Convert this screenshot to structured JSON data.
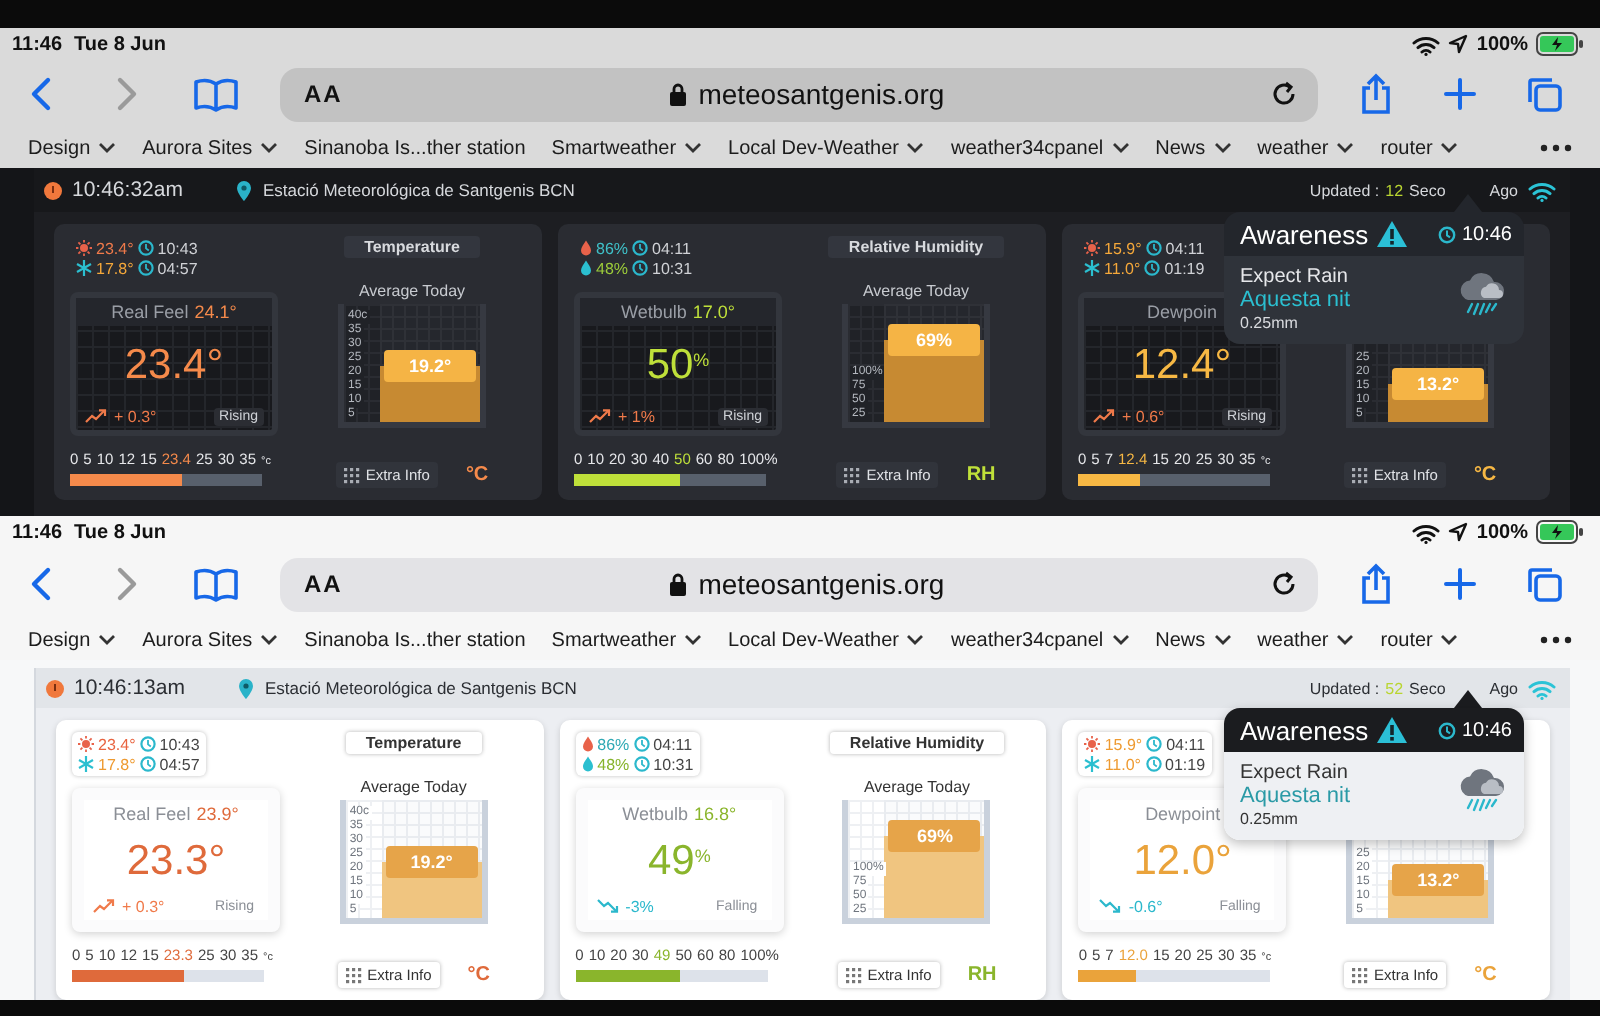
{
  "screens": [
    {
      "kind": "dark",
      "status_bar": {
        "time": "11:46",
        "date": "Tue 8 Jun",
        "battery": "100%"
      },
      "toolbar": {
        "forward_disabled": true,
        "text_size": "AA",
        "url": "meteosantgenis.org"
      },
      "bookmarks": [
        {
          "label": "Design",
          "menu": true
        },
        {
          "label": "Aurora Sites",
          "menu": true
        },
        {
          "label": "Sinanoba Is...ther station",
          "menu": false
        },
        {
          "label": "Smartweather",
          "menu": true
        },
        {
          "label": "Local Dev-Weather",
          "menu": true
        },
        {
          "label": "weather34cpanel",
          "menu": true
        },
        {
          "label": "News",
          "menu": true
        },
        {
          "label": "weather",
          "menu": true
        },
        {
          "label": "router",
          "menu": true
        }
      ],
      "header": {
        "time": "10:46:32am",
        "station": "Estació Meteorológica de Santgenis BCN",
        "updated_label": "Updated :",
        "updated_seconds": "12",
        "updated_unit": "Seco",
        "updated_ago": "Ago"
      },
      "cards": [
        {
          "kind": "temperature",
          "title": "Temperature",
          "minmax": [
            {
              "kind": "high",
              "value": "23.4°",
              "time": "10:43",
              "color": "#f07a4a"
            },
            {
              "kind": "low",
              "value": "17.8°",
              "time": "04:57",
              "color": "#f5a83a"
            }
          ],
          "panel": {
            "label": "Real Feel",
            "label_value": "24.1°",
            "value": "23.4°",
            "rising": true,
            "change": "+ 0.3°",
            "trend_text": "Rising"
          },
          "average": {
            "label": "Average Today",
            "ticks": [
              "40c",
              "35",
              "30",
              "25",
              "20",
              "15",
              "10",
              "5"
            ],
            "level": 0.48,
            "value": "19.2°"
          },
          "scale": {
            "ticks": [
              {
                "text": "0",
                "current": false
              },
              {
                "text": "5",
                "current": false
              },
              {
                "text": "10",
                "current": false
              },
              {
                "text": "12",
                "current": false
              },
              {
                "text": "15",
                "current": false
              },
              {
                "text": "23.4",
                "current": true
              },
              {
                "text": "25",
                "current": false
              },
              {
                "text": "30",
                "current": false
              },
              {
                "text": "35",
                "current": false
              }
            ],
            "unit": "°c",
            "level": 0.58
          },
          "extra": "Extra Info",
          "unit": "°C"
        },
        {
          "kind": "humidity",
          "title": "Relative Humidity",
          "minmax": [
            {
              "kind": "high",
              "value": "86%",
              "time": "04:11",
              "color": "#3fc0c8"
            },
            {
              "kind": "low",
              "value": "48%",
              "time": "10:31",
              "color": "#9ccc3a"
            }
          ],
          "panel": {
            "label": "Wetbulb",
            "label_value": "17.0°",
            "value": "50$^{%}$",
            "rising": true,
            "change": "+ 1%",
            "trend_text": "Rising"
          },
          "average": {
            "label": "Average Today",
            "ticks": [
              "100%",
              "75",
              "50",
              "25"
            ],
            "level": 0.69,
            "value": "69%"
          },
          "scale": {
            "ticks": [
              {
                "text": "0",
                "current": false
              },
              {
                "text": "10",
                "current": false
              },
              {
                "text": "20",
                "current": false
              },
              {
                "text": "30",
                "current": false
              },
              {
                "text": "40",
                "current": false
              },
              {
                "text": "50",
                "current": true
              },
              {
                "text": "60",
                "current": false
              },
              {
                "text": "80",
                "current": false
              },
              {
                "text": "100%",
                "current": false
              }
            ],
            "level": 0.55
          },
          "extra": "Extra Info",
          "unit": "RH"
        },
        {
          "kind": "dewpoint",
          "minmax": [
            {
              "kind": "high",
              "value": "15.9°",
              "time": "04:11",
              "color": "#f5a83a"
            },
            {
              "kind": "low",
              "value": "11.0°",
              "time": "01:19",
              "color": "#f5a83a"
            }
          ],
          "panel": {
            "label": "Dewpoin",
            "value": "12.4°",
            "rising": true,
            "change": "+ 0.6°",
            "trend_text": "Rising"
          },
          "average": {
            "ticks": [
              "25",
              "20",
              "15",
              "10",
              "5"
            ],
            "level": 0.33,
            "value": "13.2°"
          },
          "scale": {
            "ticks": [
              {
                "text": "0",
                "current": false
              },
              {
                "text": "5",
                "current": false
              },
              {
                "text": "7",
                "current": false
              },
              {
                "text": "12.4",
                "current": true
              },
              {
                "text": "15",
                "current": false
              },
              {
                "text": "20",
                "current": false
              },
              {
                "text": "25",
                "current": false
              },
              {
                "text": "30",
                "current": false
              },
              {
                "text": "35",
                "current": false
              }
            ],
            "unit": "°c",
            "level": 0.32
          },
          "extra": "Extra Info",
          "unit": "°C"
        }
      ],
      "alert": {
        "title": "Awareness",
        "time": "10:46",
        "heading": "Expect Rain",
        "when": "Aquesta nit",
        "amount": "0.25mm"
      }
    },
    {
      "kind": "light",
      "status_bar": {
        "time": "11:46",
        "date": "Tue 8 Jun",
        "battery": "100%"
      },
      "toolbar": {
        "forward_disabled": true,
        "text_size": "AA",
        "url": "meteosantgenis.org"
      },
      "bookmarks": [
        {
          "label": "Design",
          "menu": true
        },
        {
          "label": "Aurora Sites",
          "menu": true
        },
        {
          "label": "Sinanoba Is...ther station",
          "menu": false
        },
        {
          "label": "Smartweather",
          "menu": true
        },
        {
          "label": "Local Dev-Weather",
          "menu": true
        },
        {
          "label": "weather34cpanel",
          "menu": true
        },
        {
          "label": "News",
          "menu": true
        },
        {
          "label": "weather",
          "menu": true
        },
        {
          "label": "router",
          "menu": true
        }
      ],
      "header": {
        "time": "10:46:13am",
        "station": "Estació Meteorológica de Santgenis BCN",
        "updated_label": "Updated :",
        "updated_seconds": "52",
        "updated_unit": "Seco",
        "updated_ago": "Ago"
      },
      "cards": [
        {
          "kind": "temperature",
          "title": "Temperature",
          "minmax": [
            {
              "kind": "high",
              "value": "23.4°",
              "time": "10:43",
              "color": "#e8623e"
            },
            {
              "kind": "low",
              "value": "17.8°",
              "time": "04:57",
              "color": "#ee9a30"
            }
          ],
          "panel": {
            "label": "Real Feel",
            "label_value": "23.9°",
            "value": "23.3°",
            "rising": true,
            "change": "+ 0.3°",
            "trend_text": "Rising"
          },
          "average": {
            "label": "Average Today",
            "ticks": [
              "40c",
              "35",
              "30",
              "25",
              "20",
              "15",
              "10",
              "5"
            ],
            "level": 0.48,
            "value": "19.2°"
          },
          "scale": {
            "ticks": [
              {
                "text": "0",
                "current": false
              },
              {
                "text": "5",
                "current": false
              },
              {
                "text": "10",
                "current": false
              },
              {
                "text": "12",
                "current": false
              },
              {
                "text": "15",
                "current": false
              },
              {
                "text": "23.3",
                "current": true
              },
              {
                "text": "25",
                "current": false
              },
              {
                "text": "30",
                "current": false
              },
              {
                "text": "35",
                "current": false
              }
            ],
            "unit": "°c",
            "level": 0.58
          },
          "extra": "Extra Info",
          "unit": "°C"
        },
        {
          "kind": "humidity",
          "title": "Relative Humidity",
          "minmax": [
            {
              "kind": "high",
              "value": "86%",
              "time": "04:11",
              "color": "#2fa9b4"
            },
            {
              "kind": "low",
              "value": "48%",
              "time": "10:31",
              "color": "#86b32a"
            }
          ],
          "panel": {
            "label": "Wetbulb",
            "label_value": "16.8°",
            "value": "49$^{%}$",
            "rising": false,
            "change": "-3%",
            "trend_text": "Falling"
          },
          "average": {
            "label": "Average Today",
            "ticks": [
              "100%",
              "75",
              "50",
              "25"
            ],
            "level": 0.69,
            "value": "69%"
          },
          "scale": {
            "ticks": [
              {
                "text": "0",
                "current": false
              },
              {
                "text": "10",
                "current": false
              },
              {
                "text": "20",
                "current": false
              },
              {
                "text": "30",
                "current": false
              },
              {
                "text": "49",
                "current": true
              },
              {
                "text": "50",
                "current": false
              },
              {
                "text": "60",
                "current": false
              },
              {
                "text": "80",
                "current": false
              },
              {
                "text": "100%",
                "current": false
              }
            ],
            "level": 0.55
          },
          "extra": "Extra Info",
          "unit": "RH"
        },
        {
          "kind": "dewpoint",
          "minmax": [
            {
              "kind": "high",
              "value": "15.9°",
              "time": "04:11",
              "color": "#ee9a30"
            },
            {
              "kind": "low",
              "value": "11.0°",
              "time": "01:19",
              "color": "#ee9a30"
            }
          ],
          "panel": {
            "label": "Dewpoint",
            "value": "12.0°",
            "rising": false,
            "change": "-0.6°",
            "trend_text": "Falling"
          },
          "average": {
            "ticks": [
              "25",
              "20",
              "15",
              "10",
              "5"
            ],
            "level": 0.33,
            "value": "13.2°"
          },
          "scale": {
            "ticks": [
              {
                "text": "0",
                "current": false
              },
              {
                "text": "5",
                "current": false
              },
              {
                "text": "7",
                "current": false
              },
              {
                "text": "12.0",
                "current": true
              },
              {
                "text": "15",
                "current": false
              },
              {
                "text": "20",
                "current": false
              },
              {
                "text": "25",
                "current": false
              },
              {
                "text": "30",
                "current": false
              },
              {
                "text": "35",
                "current": false
              }
            ],
            "unit": "°c",
            "level": 0.3
          },
          "extra": "Extra Info",
          "unit": "°C"
        }
      ],
      "alert": {
        "title": "Awareness",
        "time": "10:46",
        "heading": "Expect Rain",
        "when": "Aquesta nit",
        "amount": "0.25mm"
      }
    }
  ]
}
